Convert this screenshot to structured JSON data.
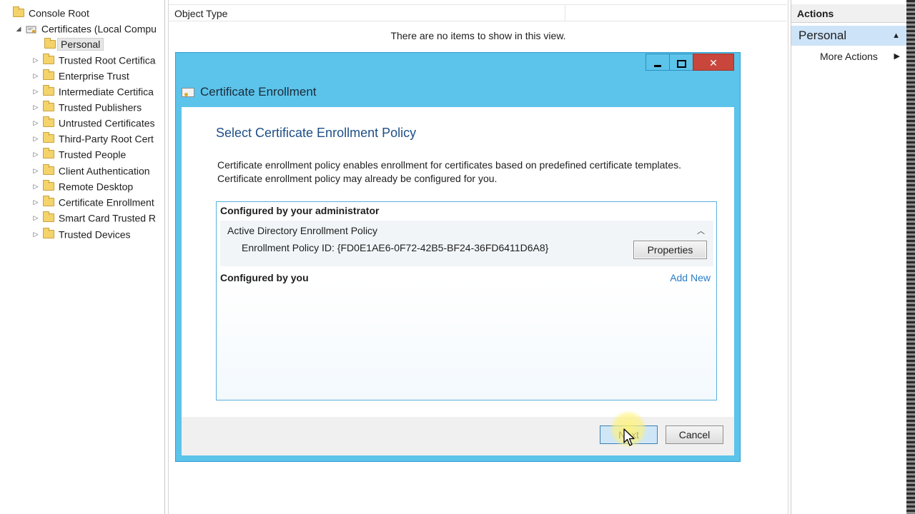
{
  "tree": {
    "root": "Console Root",
    "certificates": "Certificates (Local Compu",
    "selected": "Personal",
    "items": [
      "Trusted Root Certifica",
      "Enterprise Trust",
      "Intermediate Certifica",
      "Trusted Publishers",
      "Untrusted Certificates",
      "Third-Party Root Cert",
      "Trusted People",
      "Client Authentication",
      "Remote Desktop",
      "Certificate Enrollment",
      "Smart Card Trusted R",
      "Trusted Devices"
    ]
  },
  "middle": {
    "column_header": "Object Type",
    "empty_message": "There are no items to show in this view."
  },
  "actions": {
    "title": "Actions",
    "section": "Personal",
    "more_actions": "More Actions"
  },
  "dialog": {
    "title": "Certificate Enrollment",
    "heading": "Select Certificate Enrollment Policy",
    "description_line1": "Certificate enrollment policy enables enrollment for certificates based on predefined certificate templates.",
    "description_line2": "Certificate enrollment policy may already be configured for you.",
    "admin_header": "Configured by your administrator",
    "policy_name": "Active Directory Enrollment Policy",
    "policy_id": "Enrollment Policy ID:  {FD0E1AE6-0F72-42B5-BF24-36FD6411D6A8}",
    "properties_label": "Properties",
    "you_header": "Configured by you",
    "add_new_label": "Add New",
    "next_label": "Next",
    "cancel_label": "Cancel",
    "close_glyph": "✕"
  },
  "colors": {
    "dialog_frame": "#5cc3ea",
    "close_button": "#c9463d",
    "heading": "#1e4f87",
    "link": "#2a7cc7",
    "selection": "#cde3f7"
  }
}
